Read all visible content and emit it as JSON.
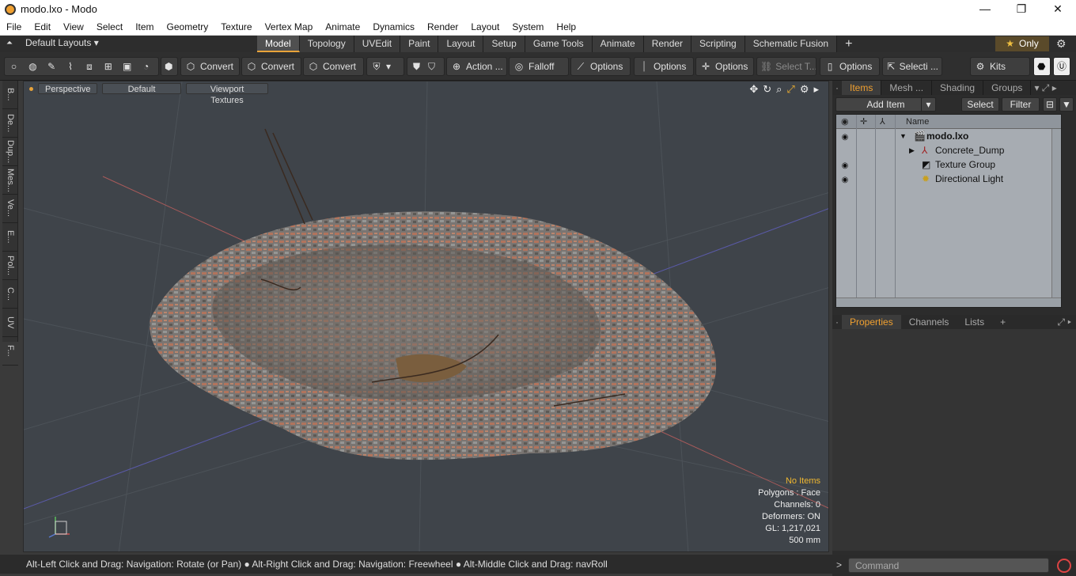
{
  "window": {
    "title": "modo.lxo - Modo",
    "min": "—",
    "max": "❐",
    "close": "✕"
  },
  "menu": [
    "File",
    "Edit",
    "View",
    "Select",
    "Item",
    "Geometry",
    "Texture",
    "Vertex Map",
    "Animate",
    "Dynamics",
    "Render",
    "Layout",
    "System",
    "Help"
  ],
  "layout": {
    "selector": "Default Layouts ▾",
    "only_label": "Only"
  },
  "tabs": [
    "Model",
    "Topology",
    "UVEdit",
    "Paint",
    "Layout",
    "Setup",
    "Game Tools",
    "Animate",
    "Render",
    "Scripting",
    "Schematic Fusion"
  ],
  "active_tab": "Model",
  "toolbar": {
    "convert1": "Convert",
    "convert2": "Convert",
    "convert3": "Convert",
    "action": "Action",
    "action_more": "...",
    "falloff": "Falloff",
    "options1": "Options",
    "options2": "Options",
    "options3": "Options",
    "select_t": "Select T...",
    "options4": "Options",
    "selecti": "Selecti ...",
    "kits": "Kits"
  },
  "left_tabs": [
    "B...",
    "De...",
    "Dup...",
    "Mes...",
    "Ve...",
    "E...",
    "Pol...",
    "C...",
    "UV",
    "F..."
  ],
  "viewport": {
    "view": "Perspective",
    "shading": "Default",
    "textures": "Viewport Textures",
    "info": {
      "items": "No Items",
      "polygons": "Polygons : Face",
      "channels": "Channels: 0",
      "deformers": "Deformers: ON",
      "gl": "GL: 1,217,021",
      "scale": "500 mm"
    }
  },
  "status": "Alt-Left Click and Drag: Navigation: Rotate (or Pan) ● Alt-Right Click and Drag: Navigation: Freewheel ● Alt-Middle Click and Drag: navRoll",
  "items_panel": {
    "tabs": [
      "Items",
      "Mesh ...",
      "Shading",
      "Groups"
    ],
    "add_item": "Add Item",
    "select": "Select",
    "filter": "Filter",
    "name_header": "Name",
    "rows": [
      {
        "name": "modo.lxo",
        "bold": true
      },
      {
        "name": "Concrete_Dump"
      },
      {
        "name": "Texture Group"
      },
      {
        "name": "Directional Light"
      }
    ]
  },
  "properties_panel": {
    "tabs": [
      "Properties",
      "Channels",
      "Lists"
    ],
    "plus": "+"
  },
  "command": {
    "placeholder": "Command",
    "prompt": ">"
  }
}
